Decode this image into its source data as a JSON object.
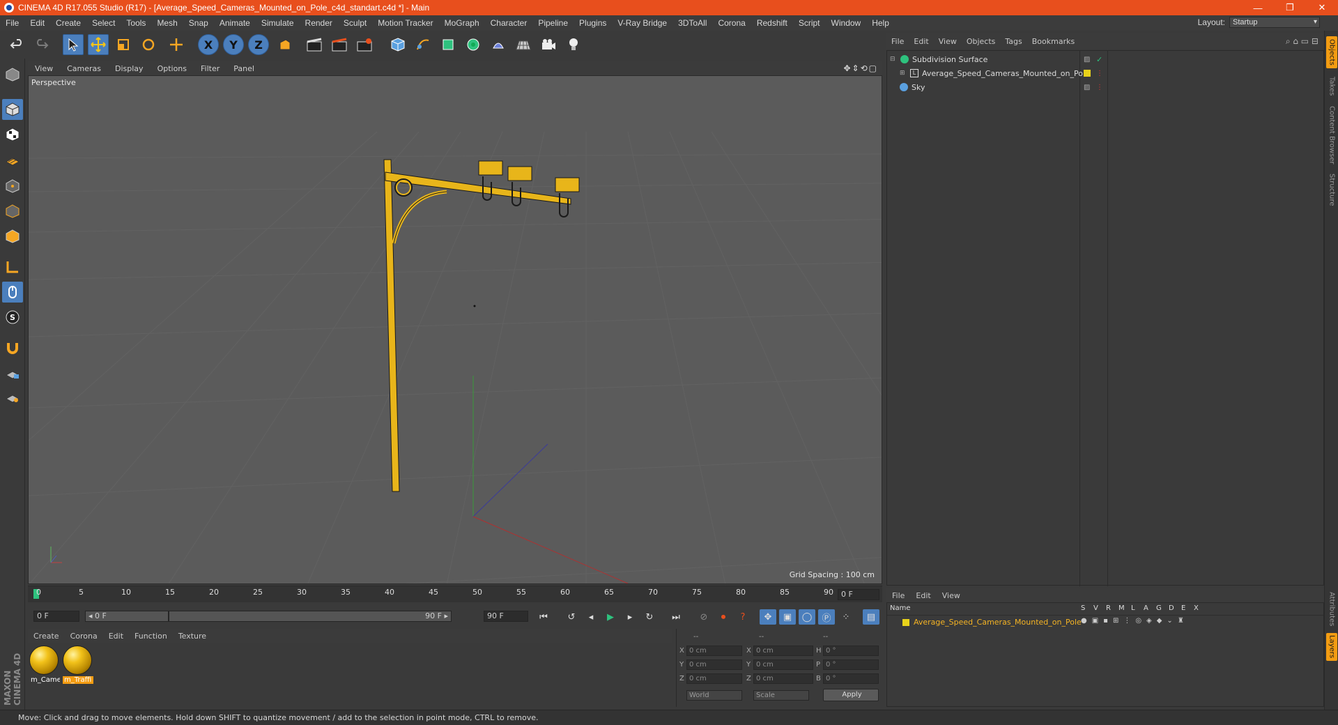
{
  "window": {
    "title": "CINEMA 4D R17.055 Studio (R17) - [Average_Speed_Cameras_Mounted_on_Pole_c4d_standart.c4d *] - Main",
    "minimize_glyph": "—",
    "restore_glyph": "❐",
    "close_glyph": "✕"
  },
  "menubar": {
    "items": [
      "File",
      "Edit",
      "Create",
      "Select",
      "Tools",
      "Mesh",
      "Snap",
      "Animate",
      "Simulate",
      "Render",
      "Sculpt",
      "Motion Tracker",
      "MoGraph",
      "Character",
      "Pipeline",
      "Plugins",
      "V-Ray Bridge",
      "3DToAll",
      "Corona",
      "Redshift",
      "Script",
      "Window",
      "Help"
    ],
    "layout_label": "Layout:",
    "layout_value": "Startup"
  },
  "toolbar": {
    "axis_x": "X",
    "axis_y": "Y",
    "axis_z": "Z"
  },
  "viewport": {
    "menu": [
      "View",
      "Cameras",
      "Display",
      "Options",
      "Filter",
      "Panel"
    ],
    "label": "Perspective",
    "grid_spacing": "Grid Spacing : 100 cm",
    "nav_icons": "✥⇕⟲▢"
  },
  "timeline": {
    "ticks": [
      "0",
      "5",
      "10",
      "15",
      "20",
      "25",
      "30",
      "35",
      "40",
      "45",
      "50",
      "55",
      "60",
      "65",
      "70",
      "75",
      "80",
      "85",
      "90"
    ],
    "current_frame": "0 F",
    "start_field": "0 F",
    "range_left": "◂ 0 F",
    "range_right": "90 F ▸",
    "end_field": "90 F"
  },
  "materials": {
    "menu": [
      "Create",
      "Corona",
      "Edit",
      "Function",
      "Texture"
    ],
    "items": [
      {
        "label": "m_Came",
        "selected": false
      },
      {
        "label": "m_Traffi",
        "selected": true
      }
    ]
  },
  "coords": {
    "headers": [
      "--",
      "--",
      "--"
    ],
    "rows": [
      {
        "a": "X",
        "av": "0 cm",
        "b": "X",
        "bv": "0 cm",
        "c": "H",
        "cv": "0 °"
      },
      {
        "a": "Y",
        "av": "0 cm",
        "b": "Y",
        "bv": "0 cm",
        "c": "P",
        "cv": "0 °"
      },
      {
        "a": "Z",
        "av": "0 cm",
        "b": "Z",
        "bv": "0 cm",
        "c": "B",
        "cv": "0 °"
      }
    ],
    "world": "World",
    "scale": "Scale",
    "apply": "Apply"
  },
  "object_manager": {
    "menu": [
      "File",
      "Edit",
      "View",
      "Objects",
      "Tags",
      "Bookmarks"
    ],
    "objects": [
      {
        "name": "Subdivision Surface",
        "indent": 0
      },
      {
        "name": "Average_Speed_Cameras_Mounted_on_Pole",
        "indent": 1
      },
      {
        "name": "Sky",
        "indent": 0
      }
    ]
  },
  "layer_manager": {
    "menu": [
      "File",
      "Edit",
      "View"
    ],
    "header_name": "Name",
    "header_cols": [
      "S",
      "V",
      "R",
      "M",
      "L",
      "A",
      "G",
      "D",
      "E",
      "X"
    ],
    "layer": "Average_Speed_Cameras_Mounted_on_Pole"
  },
  "right_tabs": [
    "Objects",
    "Takes",
    "Content Browser",
    "Structure",
    "Attributes",
    "Layers"
  ],
  "status": "Move: Click and drag to move elements. Hold down SHIFT to quantize movement / add to the selection in point mode, CTRL to remove.",
  "branding": "MAXON CINEMA 4D",
  "colors": {
    "title_bar": "#e84f1d",
    "accent_blue": "#4b7fbd",
    "model_yellow": "#e8b51a",
    "layer_orange": "#f39c12"
  }
}
